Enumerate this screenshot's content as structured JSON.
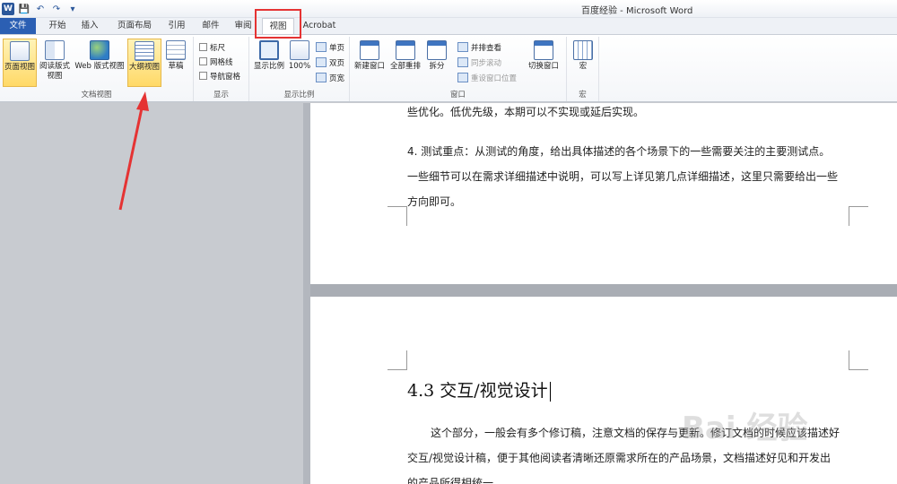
{
  "window": {
    "title": "百度经验 - Microsoft Word"
  },
  "qat": {
    "logo": "W",
    "save": "💾",
    "undo": "↶",
    "redo": "↷",
    "more": "▾"
  },
  "tabs": [
    {
      "label": "文件"
    },
    {
      "label": "开始"
    },
    {
      "label": "插入"
    },
    {
      "label": "页面布局"
    },
    {
      "label": "引用"
    },
    {
      "label": "邮件"
    },
    {
      "label": "审阅"
    },
    {
      "label": "视图"
    },
    {
      "label": "Acrobat"
    }
  ],
  "ribbon": {
    "doc_views": {
      "label": "文档视图",
      "print_layout": "页面视图",
      "reading_layout_1": "阅读版式",
      "reading_layout_2": "视图",
      "web_layout": "Web 版式视图",
      "outline": "大纲视图",
      "draft": "草稿"
    },
    "show": {
      "label": "显示",
      "ruler": "标尺",
      "gridlines": "网格线",
      "nav_pane": "导航窗格"
    },
    "zoom": {
      "label": "显示比例",
      "zoom": "显示比例",
      "hundred": "100%",
      "one_page": "单页",
      "two_pages": "双页",
      "page_width": "页宽"
    },
    "window": {
      "label": "窗口",
      "new_window": "新建窗口",
      "arrange_all": "全部重排",
      "split": "拆分",
      "side_by_side": "并排查看",
      "sync_scroll": "同步滚动",
      "reset_position": "重设窗口位置",
      "switch_windows": "切换窗口"
    },
    "macros": {
      "label": "宏",
      "macros": "宏"
    }
  },
  "document": {
    "page1": {
      "line_top": "些优化。低优先级，本期可以不实现或延后实现。",
      "para_1": "4. 测试重点：从测试的角度，给出具体描述的各个场景下的一些需要关注的主要测试点。",
      "para_2": "一些细节可以在需求详细描述中说明，可以写上详见第几点详细描述，这里只需要给出一些",
      "para_3": "方向即可。"
    },
    "page2": {
      "heading": "4.3 交互/视觉设计",
      "para_1": "这个部分，一般会有多个修订稿，注意文档的保存与更新。修订文档的时候应该描述好",
      "para_2": "交互/视觉设计稿，便于其他阅读者清晰还原需求所在的产品场景，文档描述好见和开发出",
      "para_3": "的产品所得相统一。"
    }
  },
  "watermark": "Bai 经验",
  "colors": {
    "file_tab": "#2b5fb3",
    "highlight": "#ffd967",
    "annotation": "#e53333"
  }
}
